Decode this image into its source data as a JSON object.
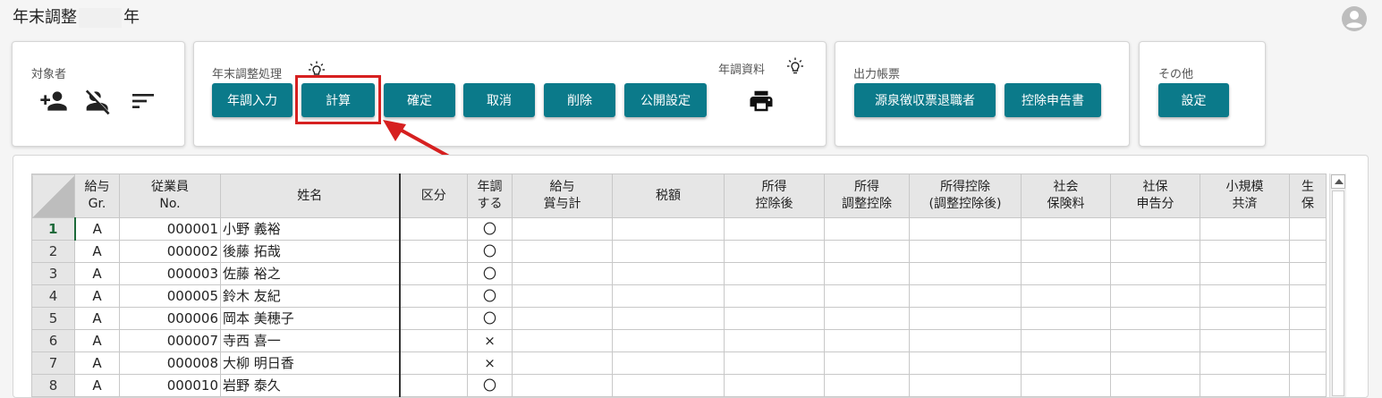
{
  "header": {
    "title_prefix": "年末調整",
    "title_suffix": "年"
  },
  "panels": {
    "target": {
      "label": "対象者"
    },
    "process": {
      "label": "年末調整処理"
    },
    "materials": {
      "label": "年調資料"
    },
    "output": {
      "label": "出力帳票"
    },
    "other": {
      "label": "その他"
    }
  },
  "buttons": {
    "nencho_input": "年調入力",
    "keisan": "計算",
    "kakutei": "確定",
    "torikeshi": "取消",
    "sakujo": "削除",
    "kokai_settei": "公開設定",
    "gensen": "源泉徴収票退職者",
    "kojo_shinkoku": "控除申告書",
    "settei": "設定"
  },
  "icons": {
    "add_user": "add-person-icon",
    "remove_user": "person-off-icon",
    "sort": "sort-icon",
    "print": "printer-icon",
    "help": "lightbulb-icon",
    "account": "account-circle-icon"
  },
  "colors": {
    "button": "#0b7a8a",
    "highlight": "#d62020",
    "selected_row": "#1d6a3a"
  },
  "grid": {
    "columns": [
      "",
      "給与\nGr.",
      "従業員\nNo.",
      "姓名",
      "区分",
      "年調\nする",
      "給与\n賞与計",
      "税額",
      "所得\n控除後",
      "所得\n調整控除",
      "所得控除\n(調整控除後)",
      "社会\n保険料",
      "社保\n申告分",
      "小規模\n共済",
      "生\n保"
    ],
    "rows": [
      {
        "no": "1",
        "gr": "A",
        "emp": "000001",
        "name": "小野 義裕",
        "kubun": "",
        "nencho": "〇"
      },
      {
        "no": "2",
        "gr": "A",
        "emp": "000002",
        "name": "後藤 拓哉",
        "kubun": "",
        "nencho": "〇"
      },
      {
        "no": "3",
        "gr": "A",
        "emp": "000003",
        "name": "佐藤 裕之",
        "kubun": "",
        "nencho": "〇"
      },
      {
        "no": "4",
        "gr": "A",
        "emp": "000005",
        "name": "鈴木 友紀",
        "kubun": "",
        "nencho": "〇"
      },
      {
        "no": "5",
        "gr": "A",
        "emp": "000006",
        "name": "岡本 美穂子",
        "kubun": "",
        "nencho": "〇"
      },
      {
        "no": "6",
        "gr": "A",
        "emp": "000007",
        "name": "寺西 喜一",
        "kubun": "",
        "nencho": "×"
      },
      {
        "no": "7",
        "gr": "A",
        "emp": "000008",
        "name": "大柳 明日香",
        "kubun": "",
        "nencho": "×"
      },
      {
        "no": "8",
        "gr": "A",
        "emp": "000010",
        "name": "岩野 泰久",
        "kubun": "",
        "nencho": "〇"
      }
    ]
  }
}
